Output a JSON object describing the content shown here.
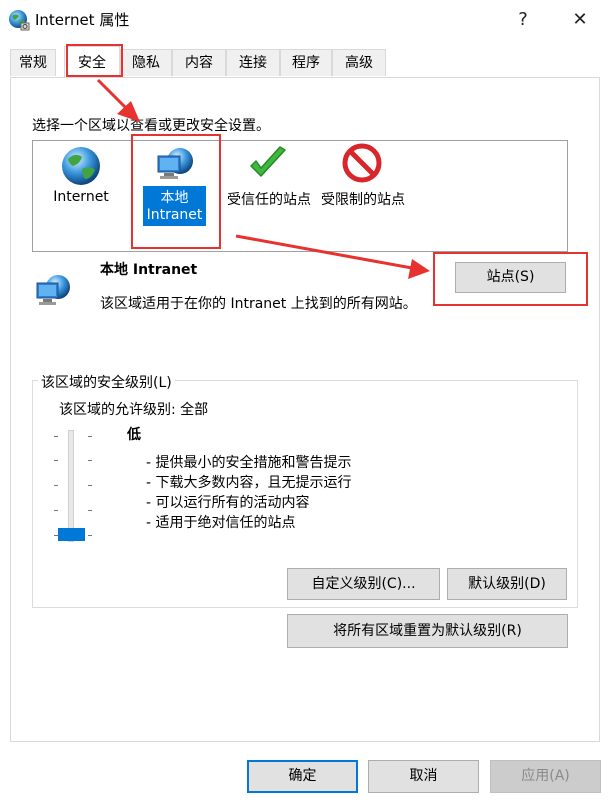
{
  "window": {
    "title": "Internet 属性",
    "help": "?",
    "close": "✕"
  },
  "tabs": [
    {
      "label": "常规"
    },
    {
      "label": "安全"
    },
    {
      "label": "隐私"
    },
    {
      "label": "内容"
    },
    {
      "label": "连接"
    },
    {
      "label": "程序"
    },
    {
      "label": "高级"
    }
  ],
  "security": {
    "instruction": "选择一个区域以查看或更改安全设置。",
    "zones": [
      {
        "label_line1": "Internet",
        "label_line2": ""
      },
      {
        "label_line1": "本地",
        "label_line2": "Intranet"
      },
      {
        "label_line1": "受信任的站点",
        "label_line2": ""
      },
      {
        "label_line1": "受限制的站点",
        "label_line2": ""
      }
    ],
    "selected_zone_title": "本地 Intranet",
    "selected_zone_desc": "该区域适用于在你的 Intranet 上找到的所有网站。",
    "sites_button": "站点(S)",
    "level_group_title": "该区域的安全级别(L)",
    "allowed_level": "该区域的允许级别: 全部",
    "current_level": "低",
    "level_fraction": 0.0,
    "bullets": [
      "- 提供最小的安全措施和警告提示",
      "- 下载大多数内容，且无提示运行",
      "- 可以运行所有的活动内容",
      "- 适用于绝对信任的站点"
    ],
    "custom_level_button": "自定义级别(C)...",
    "default_level_button": "默认级别(D)",
    "reset_all_button": "将所有区域重置为默认级别(R)"
  },
  "footer": {
    "ok": "确定",
    "cancel": "取消",
    "apply": "应用(A)"
  },
  "colors": {
    "accent": "#0078d7",
    "annotation": "#e8322f",
    "selection": "#0078d7"
  }
}
